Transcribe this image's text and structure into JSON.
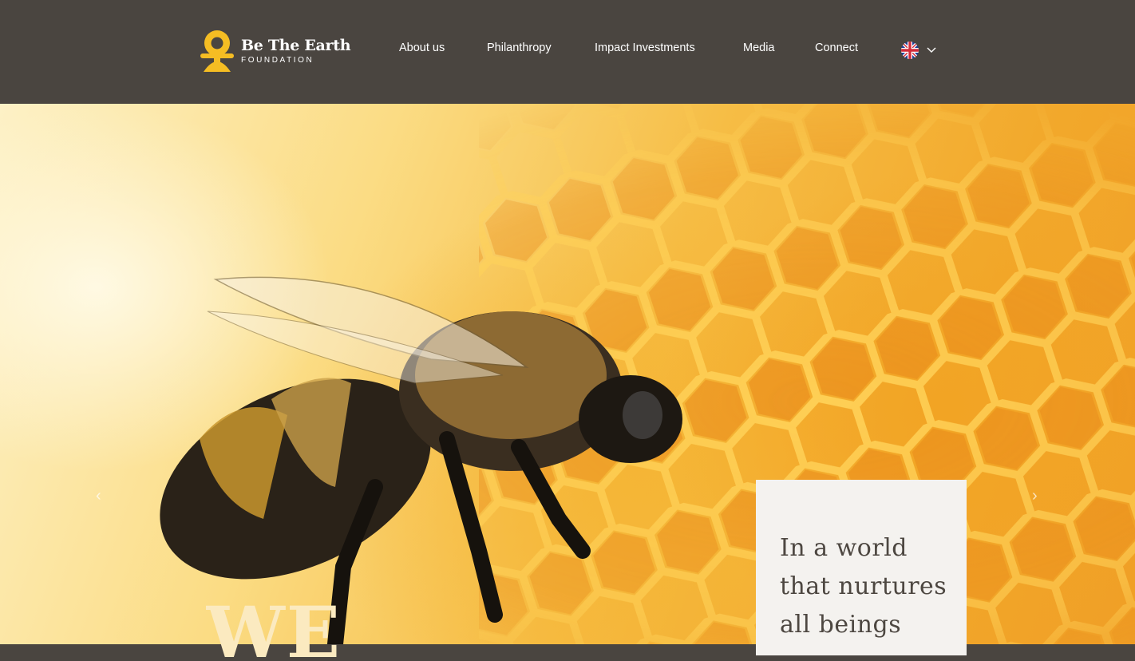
{
  "brand": {
    "name": "Be The Earth",
    "subtitle": "FOUNDATION",
    "logo_color": "#f5bd23",
    "header_bg": "#4a4540"
  },
  "nav": {
    "items": [
      {
        "label": "About us"
      },
      {
        "label": "Philanthropy"
      },
      {
        "label": "Impact Investments"
      },
      {
        "label": "Media"
      },
      {
        "label": "Connect"
      }
    ],
    "language": {
      "icon": "uk-flag-icon",
      "caret_icon": "chevron-down-icon"
    }
  },
  "hero": {
    "headline": "WE BELIEVE",
    "prev_icon": "chevron-left-icon",
    "next_icon": "chevron-right-icon",
    "prev_glyph": "‹",
    "next_glyph": "›",
    "card_text": "In a world that nurtures all beings"
  }
}
